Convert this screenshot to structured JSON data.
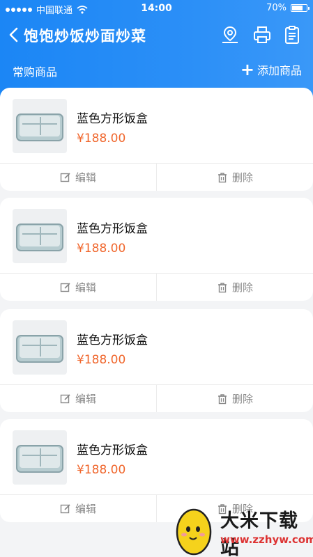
{
  "status_bar": {
    "carrier": "中国联通",
    "time": "14:00",
    "battery": "70%"
  },
  "nav": {
    "title": "饱饱炒饭炒面炒菜",
    "icons": [
      "location-icon",
      "printer-icon",
      "clipboard-icon"
    ]
  },
  "section": {
    "title": "常购商品",
    "add_label": "添加商品"
  },
  "products": [
    {
      "name": "蓝色方形饭盒",
      "price": "¥188.00",
      "edit_label": "编辑",
      "delete_label": "删除"
    },
    {
      "name": "蓝色方形饭盒",
      "price": "¥188.00",
      "edit_label": "编辑",
      "delete_label": "删除"
    },
    {
      "name": "蓝色方形饭盒",
      "price": "¥188.00",
      "edit_label": "编辑",
      "delete_label": "删除"
    },
    {
      "name": "蓝色方形饭盒",
      "price": "¥188.00",
      "edit_label": "编辑",
      "delete_label": "删除"
    }
  ],
  "watermark": {
    "text": "大米下载站",
    "url": "www.zzhyw.com"
  },
  "colors": {
    "header": "#1b86f5",
    "price": "#f0662c",
    "background": "#f3f4f6"
  }
}
